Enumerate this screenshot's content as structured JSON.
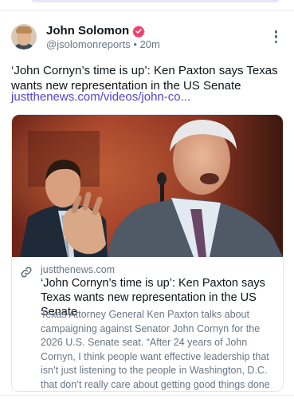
{
  "post": {
    "author": {
      "name": "John Solomon",
      "verified_icon": "verified-badge-icon",
      "handle": "@jsolomonreports",
      "separator": "•",
      "time": "20m"
    },
    "more_icon": "more-options-icon",
    "text": "‘John Cornyn’s time is up’: Ken Paxton says Texas wants new representation in the US Senate",
    "link_text": "justthenews.com/videos/john-co...",
    "card": {
      "link_icon": "link-icon",
      "domain": "justthenews.com",
      "title": "‘John Cornyn’s time is up’: Ken Paxton says Texas wants new representation in the US Senate",
      "description": "Texas Attorney General Ken Paxton talks about campaigning against Senator John Cornyn for the 2026 U.S. Senate seat. “After 24 years of John Cornyn, I think people want effective leadership that isn’t just listening to the people in Washington, D.C. that don’t really care about getting good things done for America,” he says."
    }
  },
  "colors": {
    "link": "#5146d6",
    "badge": "#ef3f6b",
    "muted": "#687785",
    "text": "#0f1419"
  }
}
